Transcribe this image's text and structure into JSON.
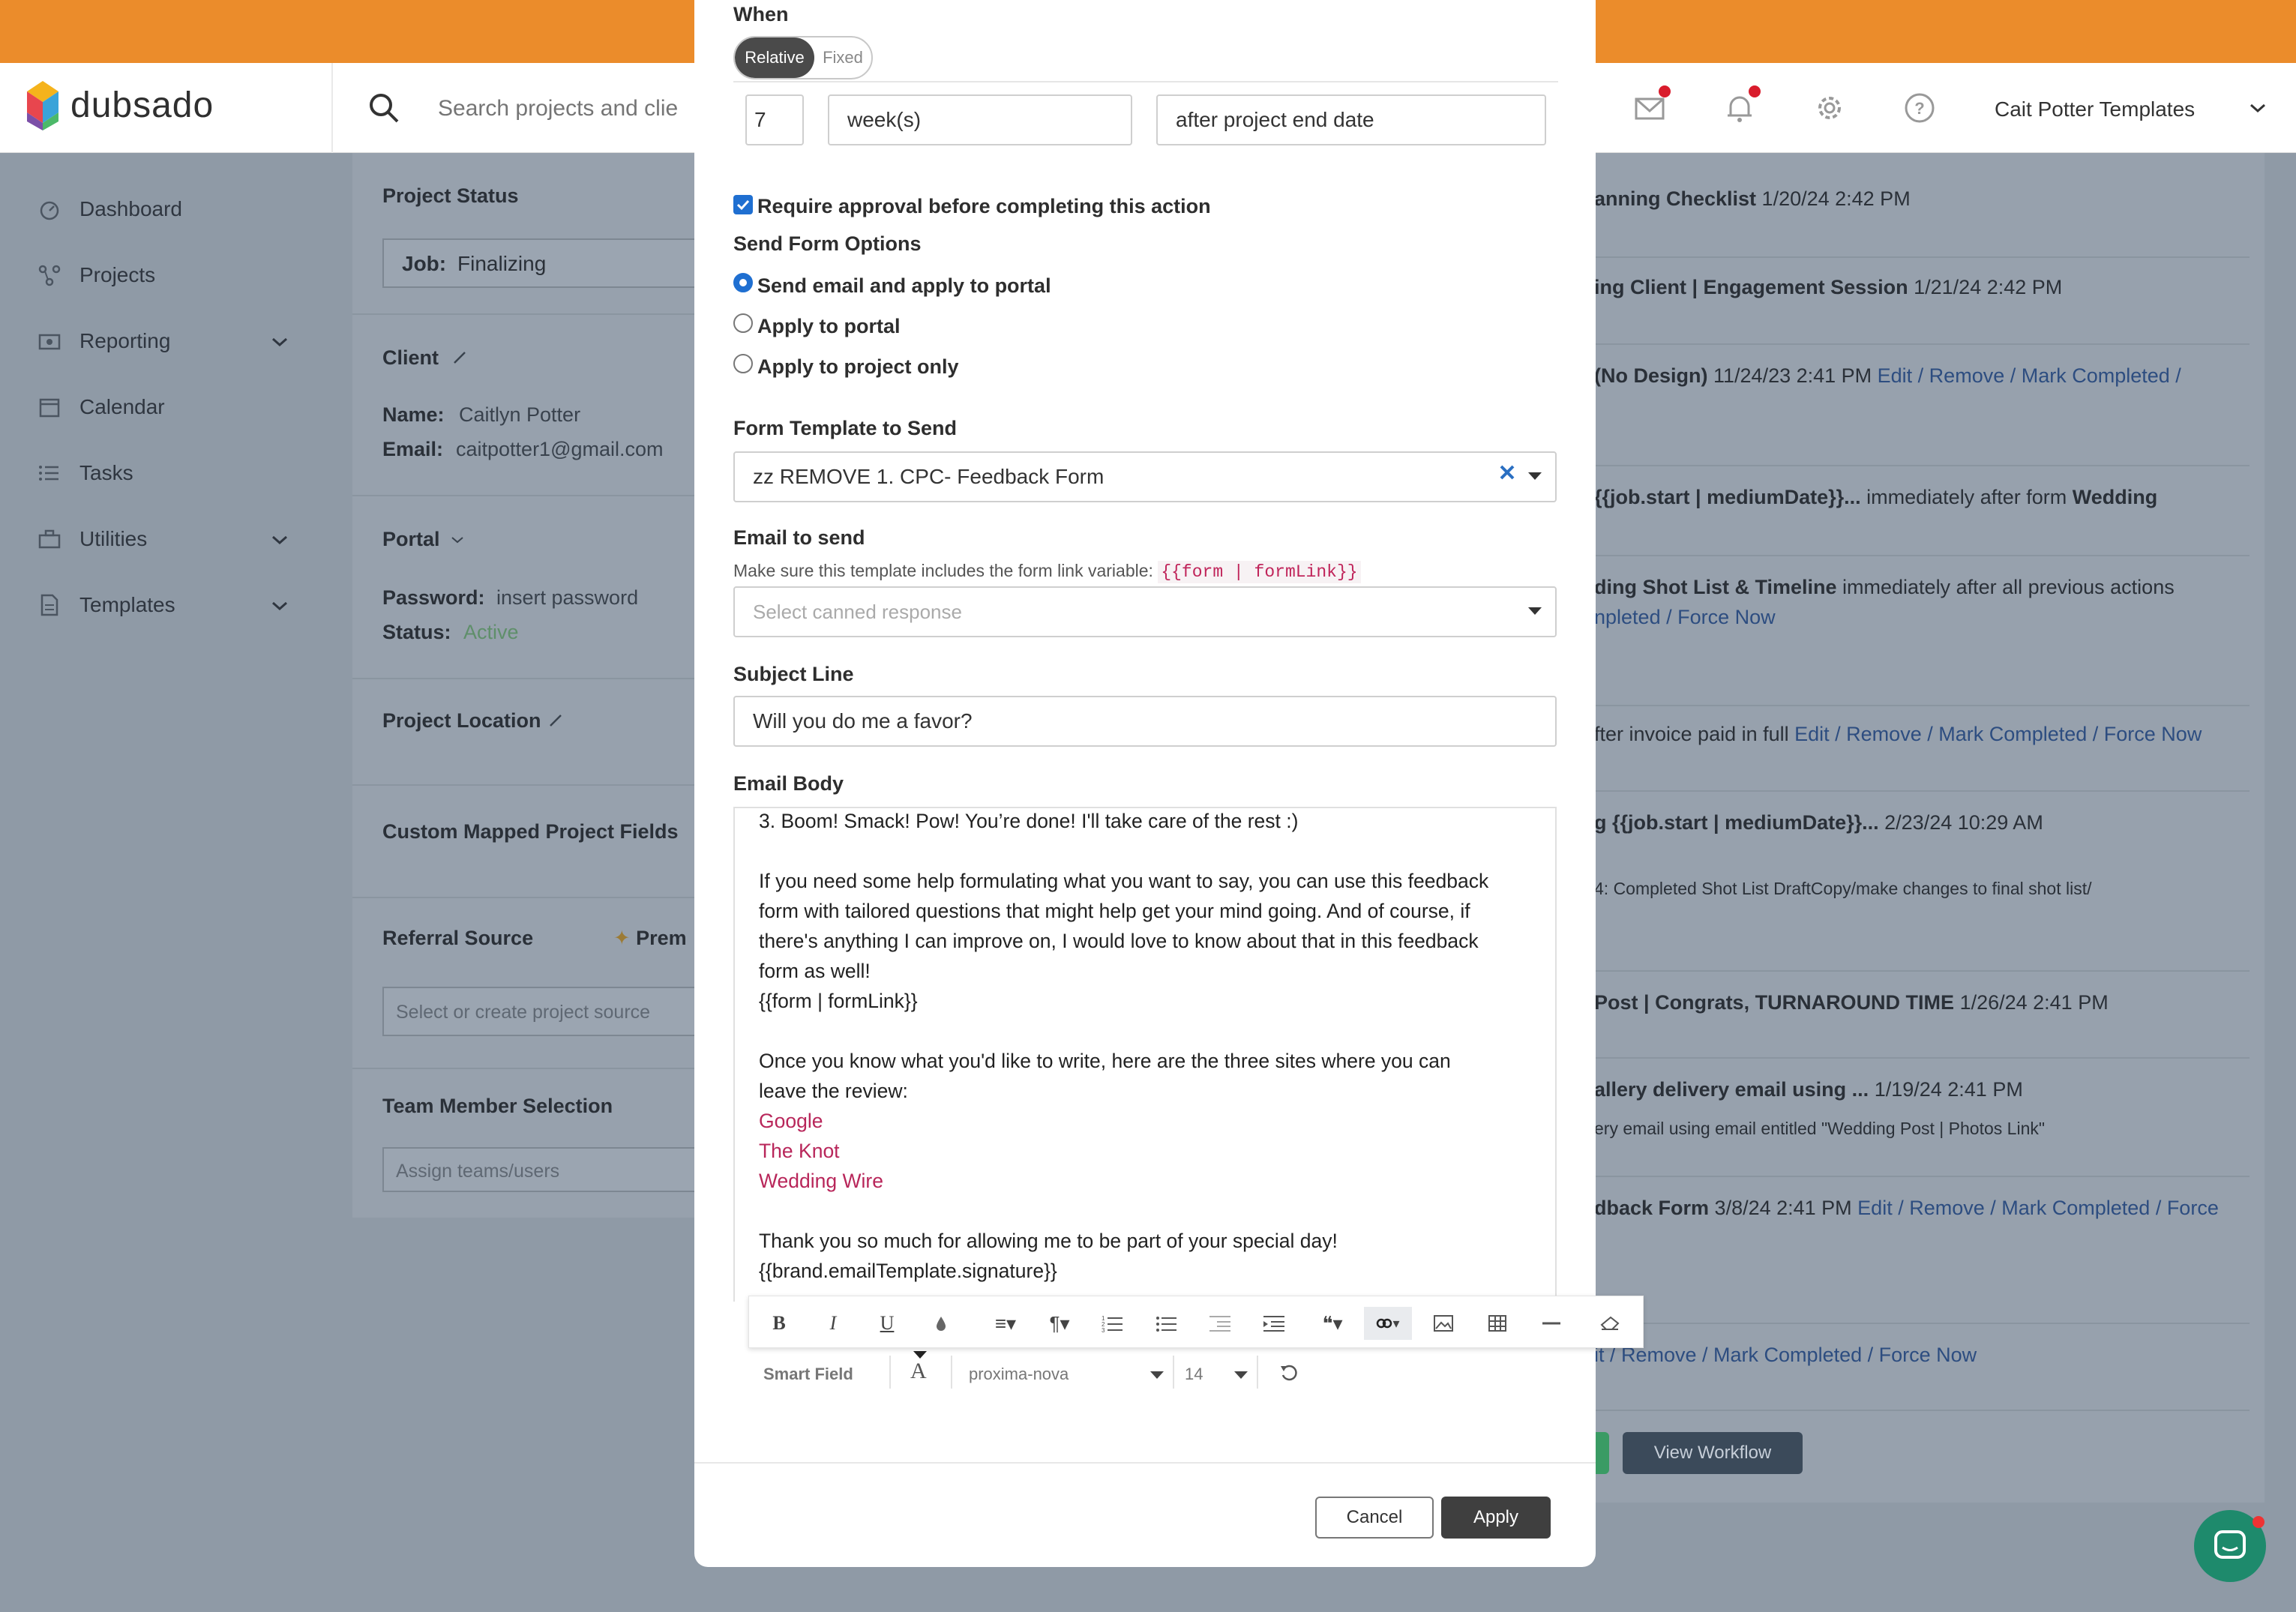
{
  "app": {
    "brand": "dubsado",
    "search_placeholder": "Search projects and clie",
    "account_name": "Cait Potter Templates"
  },
  "sidebar": {
    "items": [
      {
        "label": "Dashboard"
      },
      {
        "label": "Projects"
      },
      {
        "label": "Reporting"
      },
      {
        "label": "Calendar"
      },
      {
        "label": "Tasks"
      },
      {
        "label": "Utilities"
      },
      {
        "label": "Templates"
      }
    ]
  },
  "project_panel": {
    "status_title": "Project Status",
    "status_prefix": "Job:",
    "status_value": "Finalizing",
    "client_title": "Client",
    "name_label": "Name:",
    "name_value": "Caitlyn Potter",
    "email_label": "Email:",
    "email_value": "caitpotter1@gmail.com",
    "portal_title": "Portal",
    "password_label": "Password:",
    "password_value": "insert password",
    "portal_status_label": "Status:",
    "portal_status_value": "Active",
    "location_title": "Project Location",
    "custom_fields_title": "Custom Mapped Project Fields",
    "referral_title": "Referral Source",
    "premium_label": "Prem",
    "referral_placeholder": "Select or create project source",
    "team_title": "Team Member Selection",
    "team_placeholder": "Assign teams/users"
  },
  "workflow_list": {
    "rows": [
      {
        "bold": "anning Checklist",
        "text": " 1/20/24 2:42 PM",
        "links": ""
      },
      {
        "bold": "ing Client | Engagement Session",
        "text": " 1/21/24 2:42 PM",
        "links": ""
      },
      {
        "bold": "(No Design)",
        "text": " 11/24/23 2:41 PM ",
        "links": "Edit / Remove / Mark Completed /"
      },
      {
        "bold": "{{job.start | mediumDate}}...",
        "text": " immediately after form ",
        "bold2": "Wedding"
      },
      {
        "bold": "ding Shot List & Timeline",
        "text": " immediately after all previous actions",
        "links2": "npleted / Force Now"
      },
      {
        "bold": "",
        "text": "fter invoice paid in full ",
        "links": "Edit / Remove / Mark Completed / Force Now"
      },
      {
        "bold": "g {{job.start | mediumDate}}...",
        "text": " 2/23/24 10:29 AM",
        "sub": "4: Completed Shot List DraftCopy/make changes to final shot list/"
      },
      {
        "bold": "Post | Congrats, TURNAROUND TIME",
        "text": " 1/26/24 2:41 PM"
      },
      {
        "bold": "allery delivery email using ...",
        "text": " 1/19/24 2:41 PM",
        "sub": "ery email using email entitled \"Wedding Post | Photos Link\""
      },
      {
        "bold": "dback Form",
        "text": " 3/8/24 2:41 PM ",
        "links": "Edit / Remove / Mark Completed / Force"
      },
      {
        "bold": "",
        "text": "",
        "links": "it / Remove / Mark Completed / Force Now"
      }
    ],
    "view_workflow": "View Workflow"
  },
  "modal": {
    "when_label": "When",
    "seg_relative": "Relative",
    "seg_fixed": "Fixed",
    "amount": "7",
    "unit": "week(s)",
    "anchor": "after project end date",
    "require_approval": "Require approval before completing this action",
    "send_options_label": "Send Form Options",
    "opt_email_portal": "Send email and apply to portal",
    "opt_portal": "Apply to portal",
    "opt_project": "Apply to project only",
    "form_template_label": "Form Template to Send",
    "form_template_value": "zz REMOVE 1. CPC- Feedback Form",
    "email_to_send_label": "Email to send",
    "email_help": "Make sure this template includes the form link variable: ",
    "email_help_code": "{{form | formLink}}",
    "canned_placeholder": "Select canned response",
    "subject_label": "Subject Line",
    "subject_value": "Will you do me a favor?",
    "body_label": "Email Body",
    "body_lines": [
      "3. Boom! Smack! Pow! You’re done! I'll take care of the rest :)",
      "",
      "If you need some help formulating what you want to say, you can use this feedback",
      "form with tailored questions that might help get your mind going. And of course, if",
      "there's anything I can improve on, I would love to know about that in this feedback",
      "form as well!",
      "{{form | formLink}}",
      "",
      "Once you know what you'd like to write, here are the three sites where you can",
      "leave the review:",
      "Google",
      "The Knot",
      "Wedding Wire",
      "",
      "Thank you so much for allowing me to be part of your special day!",
      "{{brand.emailTemplate.signature}}"
    ],
    "smart_field": "Smart Field",
    "font_name": "proxima-nova",
    "font_size": "14",
    "cancel": "Cancel",
    "apply": "Apply"
  },
  "colors": {
    "topbar": "#eb8c2b",
    "primary_check": "#1f6fd1",
    "link_pink": "#b8265a",
    "apply_button": "#3f3f3f"
  }
}
